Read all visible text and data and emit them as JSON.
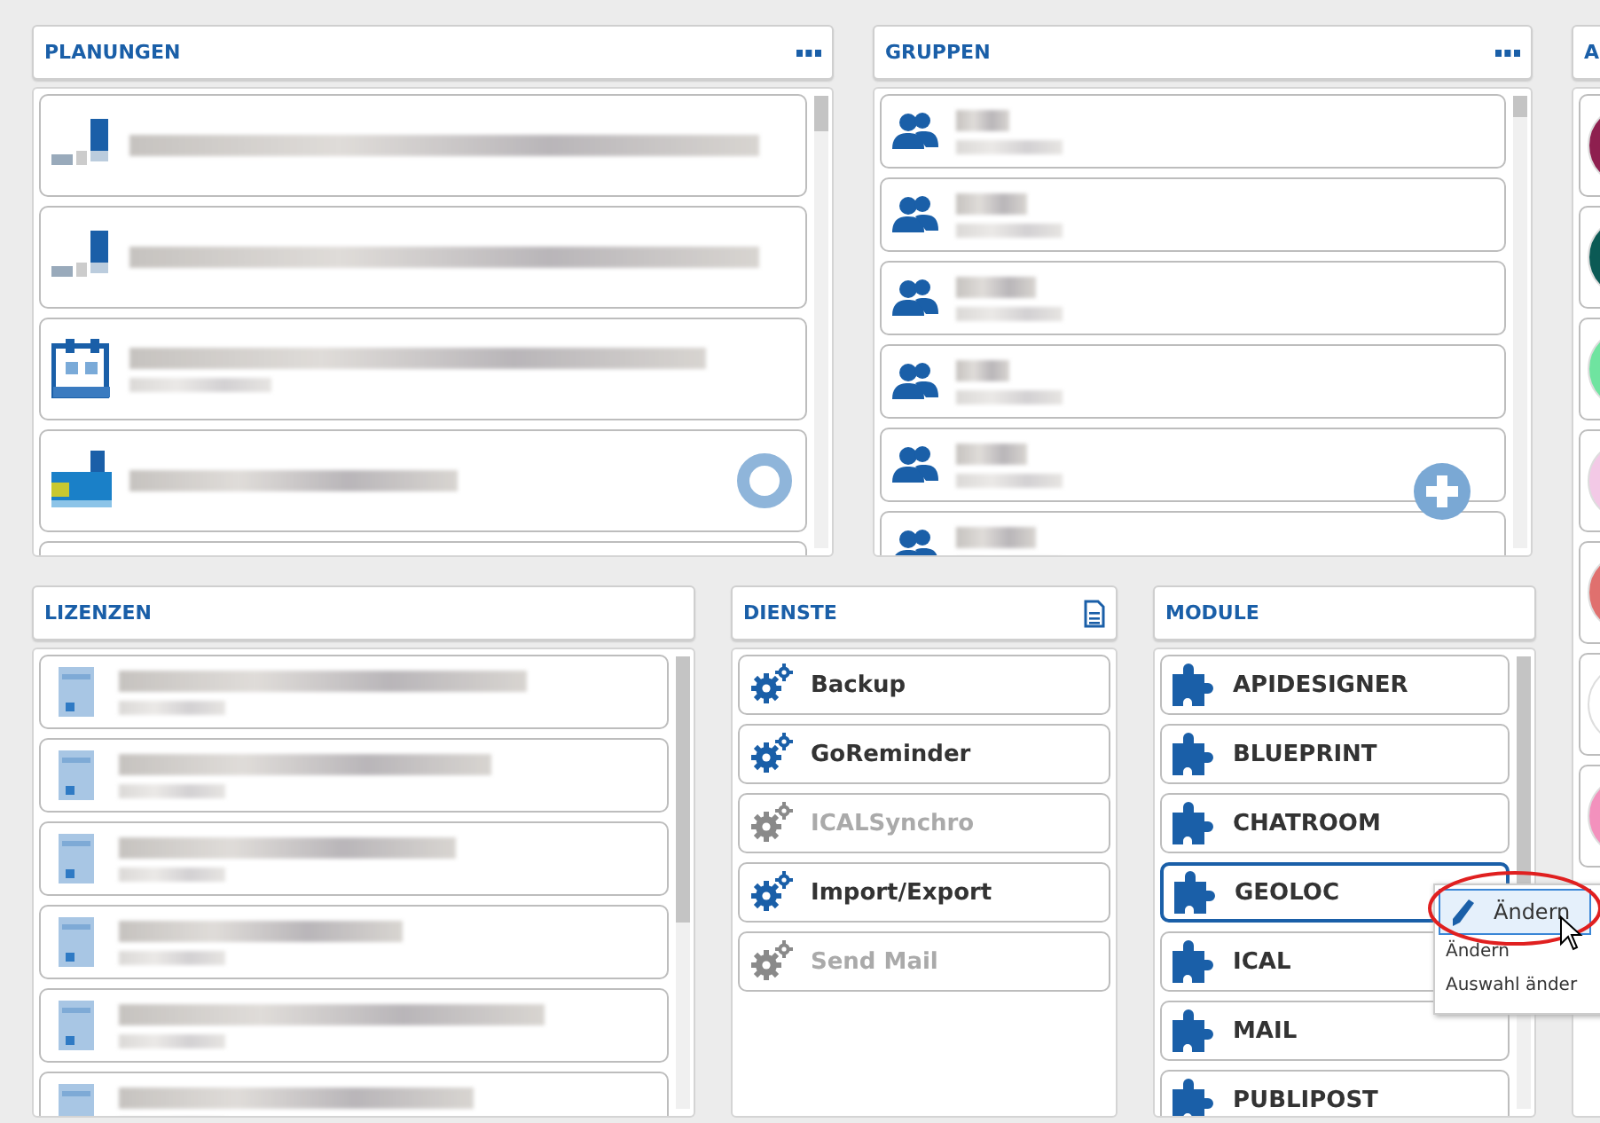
{
  "planungen": {
    "title": "PLANUNGEN",
    "items": [
      {
        "kind": "chart",
        "subtitle": false,
        "action": false
      },
      {
        "kind": "chart",
        "subtitle": false,
        "action": false
      },
      {
        "kind": "calendar",
        "subtitle": true,
        "action": false
      },
      {
        "kind": "map",
        "subtitle": false,
        "action": true
      }
    ]
  },
  "gruppen": {
    "title": "GRUPPEN"
  },
  "side": {
    "title": "A",
    "avatars": [
      {
        "color": "#8e1f4f"
      },
      {
        "color": "#0b5a55"
      },
      {
        "color": "#6fe4a0"
      },
      {
        "color": "#f3c9e6"
      },
      {
        "color": "#e0706e"
      },
      {
        "color": "#ffffff"
      },
      {
        "color": "#f391bd"
      }
    ]
  },
  "lizenzen": {
    "title": "LIZENZEN"
  },
  "dienste": {
    "title": "DIENSTE",
    "items": [
      {
        "label": "Backup",
        "disabled": false
      },
      {
        "label": "GoReminder",
        "disabled": false
      },
      {
        "label": "ICALSynchro",
        "disabled": true
      },
      {
        "label": "Import/Export",
        "disabled": false
      },
      {
        "label": "Send Mail",
        "disabled": true
      }
    ]
  },
  "module": {
    "title": "MODULE",
    "items": [
      {
        "label": "APIDESIGNER",
        "selected": false
      },
      {
        "label": "BLUEPRINT",
        "selected": false
      },
      {
        "label": "CHATROOM",
        "selected": false
      },
      {
        "label": "GEOLOC",
        "selected": true
      },
      {
        "label": "ICAL",
        "selected": false
      },
      {
        "label": "MAIL",
        "selected": false
      },
      {
        "label": "PUBLIPOST",
        "selected": false
      }
    ]
  },
  "context_menu": {
    "items": [
      {
        "label": "Ändern",
        "kind": "icon",
        "selected": true
      },
      {
        "label": "Ändern",
        "kind": "plain",
        "selected": false
      },
      {
        "label": "Auswahl änder",
        "kind": "plain",
        "selected": false
      }
    ]
  }
}
